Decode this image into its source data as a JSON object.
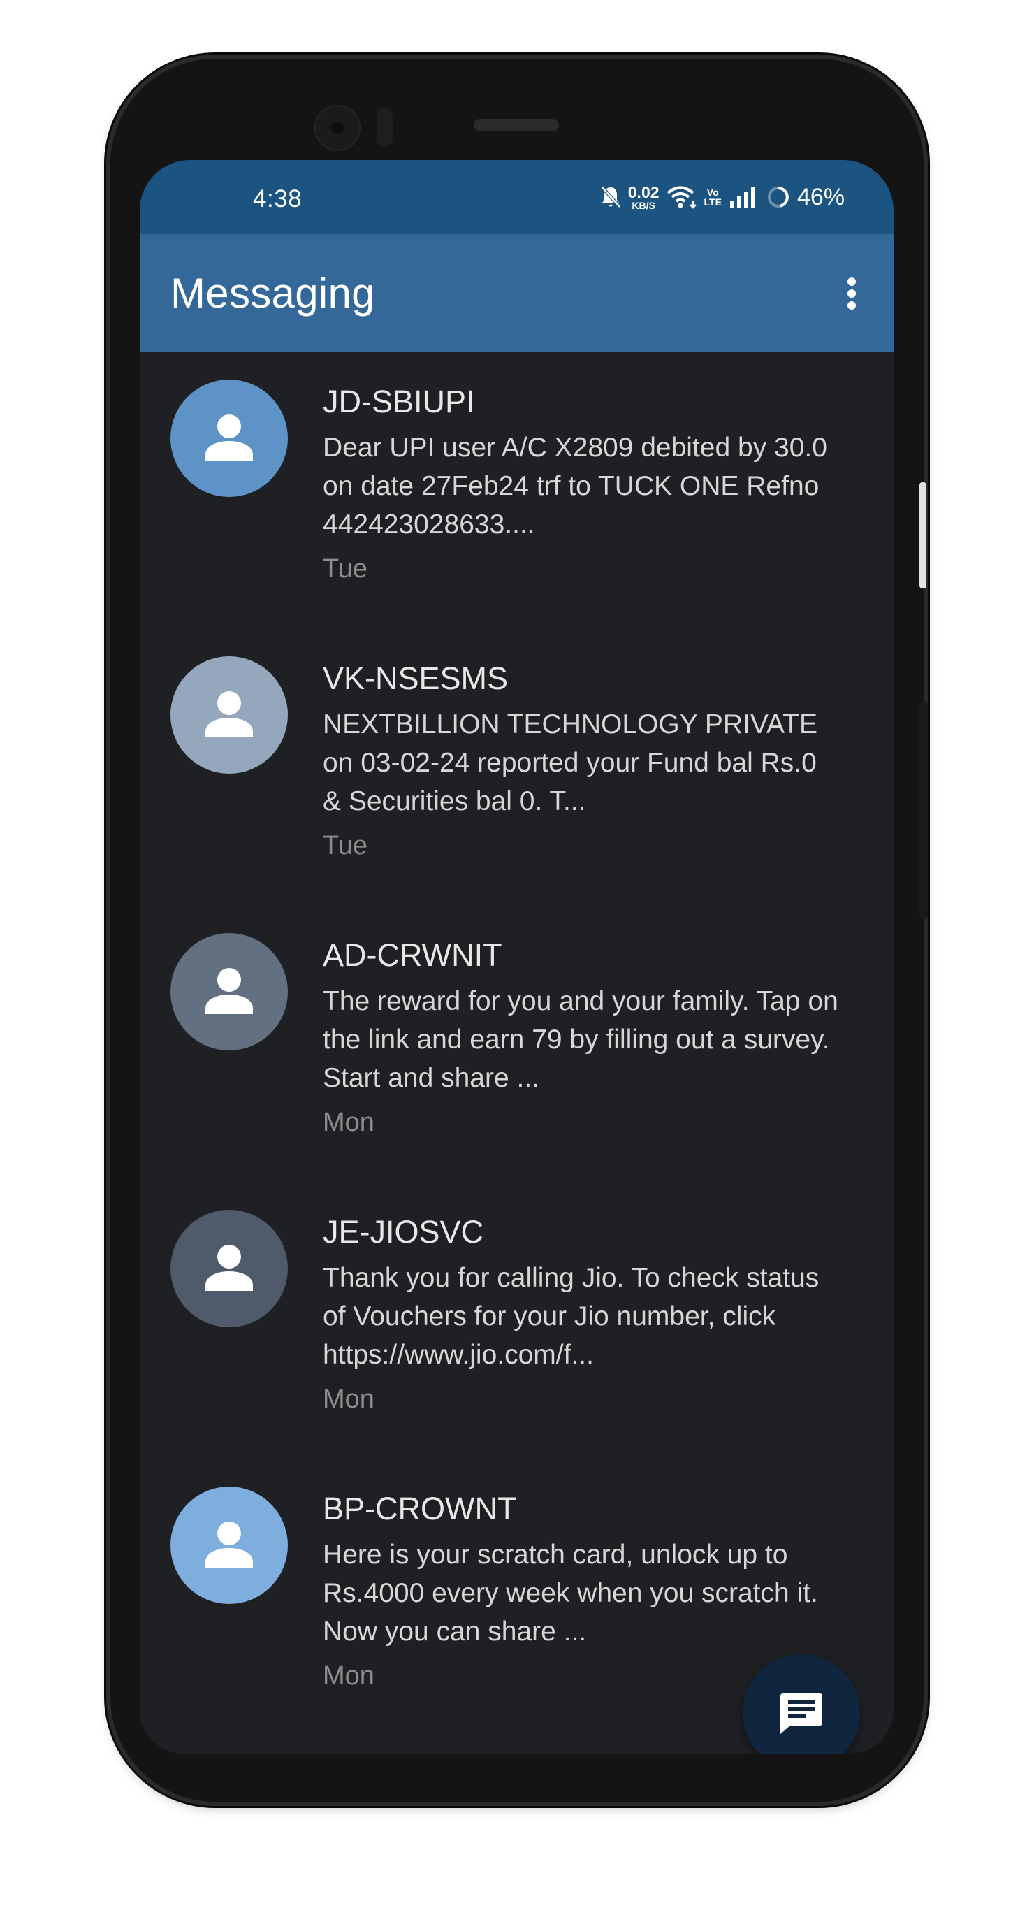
{
  "status_bar": {
    "time": "4:38",
    "net_speed_value": "0.02",
    "net_speed_unit": "KB/S",
    "volte_top": "Vo",
    "volte_bottom": "LTE",
    "battery": "46%",
    "icons": [
      "bell-muted-icon",
      "wifi-icon",
      "signal-icon",
      "battery-ring-icon"
    ]
  },
  "app_bar": {
    "title": "Messaging",
    "menu_icon": "more-vert-icon"
  },
  "conversations": [
    {
      "sender": "JD-SBIUPI",
      "snippet": "Dear UPI user A/C X2809 debited by 30.0 on date 27Feb24 trf to TUCK ONE Refno 442423028633....",
      "time": "Tue",
      "avatar_color": "#5d93c6"
    },
    {
      "sender": "VK-NSESMS",
      "snippet": "NEXTBILLION TECHNOLOGY PRIVATE on 03-02-24 reported your Fund bal Rs.0 & Securities bal 0. T...",
      "time": "Tue",
      "avatar_color": "#95a7bd"
    },
    {
      "sender": "AD-CRWNIT",
      "snippet": "The reward for you and your family. Tap on the link and earn 79  by filling out a survey. Start and share ...",
      "time": "Mon",
      "avatar_color": "#637082"
    },
    {
      "sender": "JE-JIOSVC",
      "snippet": "Thank you for calling Jio. To check status of Vouchers for your Jio number, click https://www.jio.com/f...",
      "time": "Mon",
      "avatar_color": "#4f5b6a"
    },
    {
      "sender": "BP-CROWNT",
      "snippet": "Here is your scratch card, unlock up to Rs.4000 every week when you scratch it. Now you can share ...",
      "time": "Mon",
      "avatar_color": "#7eaede"
    }
  ],
  "fab": {
    "icon": "new-message-icon"
  },
  "colors": {
    "status_bar": "#1b5480",
    "app_bar": "#336899",
    "background": "#1f2023",
    "fab": "#10263f"
  }
}
